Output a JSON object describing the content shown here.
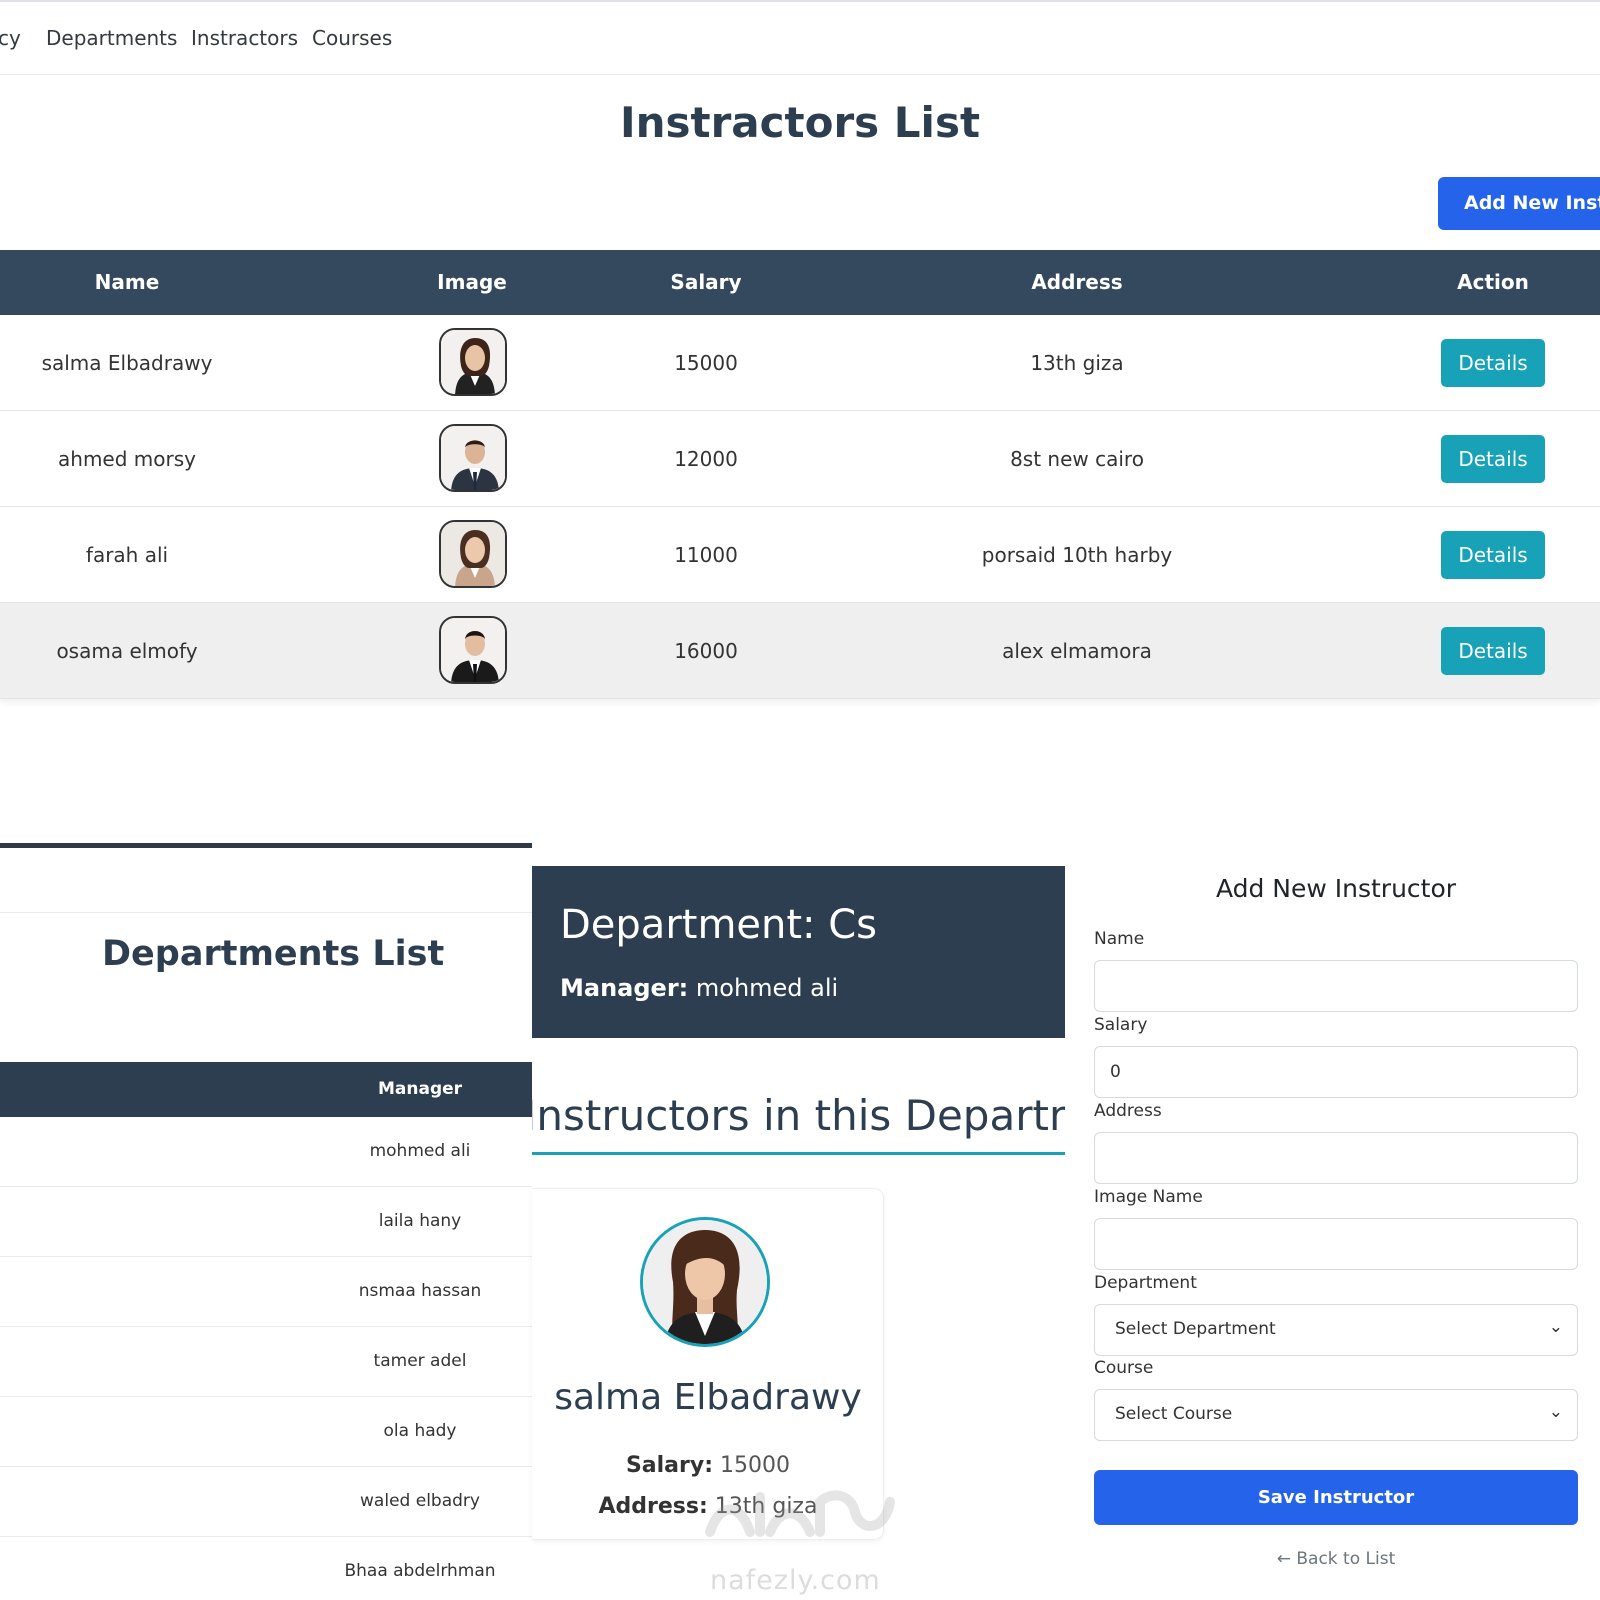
{
  "nav": {
    "items": [
      "cy",
      "Departments",
      "Instractors",
      "Courses"
    ]
  },
  "instructors_page": {
    "title": "Instractors List",
    "add_button": "Add New Instractor",
    "columns": [
      "Name",
      "Image",
      "Salary",
      "Address",
      "Action"
    ],
    "rows": [
      {
        "name": "salma Elbadrawy",
        "salary": "15000",
        "address": "13th giza",
        "action": "Details",
        "avatar": "female-avatar"
      },
      {
        "name": "ahmed morsy",
        "salary": "12000",
        "address": "8st new cairo",
        "action": "Details",
        "avatar": "male-avatar"
      },
      {
        "name": "farah ali",
        "salary": "11000",
        "address": "porsaid 10th harby",
        "action": "Details",
        "avatar": "female-avatar"
      },
      {
        "name": "osama elmofy",
        "salary": "16000",
        "address": "alex elmamora",
        "action": "Details",
        "avatar": "male-avatar"
      }
    ]
  },
  "departments_page": {
    "title": "Departments List",
    "column": "Manager",
    "managers": [
      "mohmed ali",
      "laila hany",
      "nsmaa hassan",
      "tamer adel",
      "ola hady",
      "waled elbadry",
      "Bhaa abdelrhman"
    ]
  },
  "department_details": {
    "title": "Department: Cs",
    "manager_label": "Manager:",
    "manager_value": "mohmed ali",
    "section_heading": "Instructors in this Department",
    "card": {
      "name": "salma Elbadrawy",
      "salary_label": "Salary:",
      "salary_value": "15000",
      "address_label": "Address:",
      "address_value": "13th giza"
    }
  },
  "add_form": {
    "title": "Add New Instructor",
    "labels": {
      "name": "Name",
      "salary": "Salary",
      "address": "Address",
      "image": "Image Name",
      "department": "Department",
      "course": "Course"
    },
    "values": {
      "name": "",
      "salary": "0",
      "address": "",
      "image": ""
    },
    "department_select": "Select Department",
    "course_select": "Select Course",
    "save": "Save Instructor",
    "back": "← Back to List"
  },
  "watermark": {
    "arabic": "نفذلي",
    "latin": "nafezly.com"
  },
  "colors": {
    "header_dark": "#34495e",
    "accent_blue": "#2563eb",
    "teal": "#17a2b8"
  }
}
